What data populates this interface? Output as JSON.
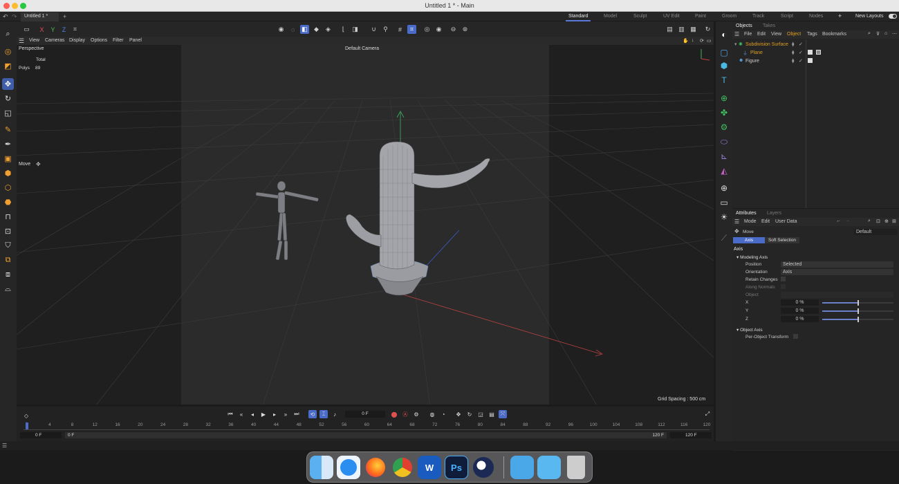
{
  "window": {
    "title": "Untitled 1 * - Main"
  },
  "tabs": {
    "document": "Untitled 1 *",
    "add": "+"
  },
  "layouts": {
    "items": [
      "Standard",
      "Model",
      "Sculpt",
      "UV Edit",
      "Paint",
      "Groom",
      "Track",
      "Script",
      "Nodes"
    ],
    "active": "Standard",
    "add": "+",
    "new_layouts": "New Layouts"
  },
  "axis_toggle": {
    "x": "X",
    "y": "Y",
    "z": "Z"
  },
  "viewport_menu": [
    "View",
    "Cameras",
    "Display",
    "Options",
    "Filter",
    "Panel"
  ],
  "viewport": {
    "view_name": "Perspective",
    "camera": "Default Camera",
    "stats_header": "Total",
    "stats_label": "Polys",
    "stats_value": "89",
    "tool_label": "Move",
    "grid_spacing": "Grid Spacing : 500 cm"
  },
  "timeline": {
    "current_frame": "0 F",
    "ticks": [
      "0",
      "4",
      "8",
      "12",
      "16",
      "20",
      "24",
      "28",
      "32",
      "36",
      "40",
      "44",
      "48",
      "52",
      "56",
      "60",
      "64",
      "68",
      "72",
      "76",
      "80",
      "84",
      "88",
      "92",
      "96",
      "100",
      "104",
      "108",
      "112",
      "116",
      "120"
    ],
    "range_start": "0 F",
    "range_start2": "0 F",
    "range_end": "120 F",
    "range_end2": "120 F"
  },
  "objects_panel": {
    "tabs": [
      "Objects",
      "Takes"
    ],
    "menu": [
      "File",
      "Edit",
      "View",
      "Object",
      "Tags",
      "Bookmarks"
    ],
    "items": [
      {
        "name": "Subdivision Surface",
        "color": "#e0a020"
      },
      {
        "name": "Plane",
        "color": "#e0a020"
      },
      {
        "name": "Figure",
        "color": "#d0d0d0"
      }
    ]
  },
  "attributes_panel": {
    "tabs": [
      "Attributes",
      "Layers"
    ],
    "menu": [
      "Mode",
      "Edit",
      "User Data"
    ],
    "tool": "Move",
    "preset": "Default",
    "subtabs": [
      "Axis",
      "Soft Selection"
    ],
    "section": "Axis",
    "group1": "Modeling Axis",
    "position_label": "Position",
    "position_value": "Selected",
    "orientation_label": "Orientation",
    "orientation_value": "Axis",
    "retain": "Retain Changes",
    "along": "Along Normals",
    "object_label": "Object",
    "x_label": "X",
    "x_value": "0 %",
    "y_label": "Y",
    "y_value": "0 %",
    "z_label": "Z",
    "z_value": "0 %",
    "group2": "Object Axis",
    "per_object": "Per-Object Transform"
  },
  "colors": {
    "accent": "#4a6cc8",
    "x_axis": "#c84040",
    "y_axis": "#40c060",
    "z_axis": "#4060d0"
  },
  "dock": {
    "apps": [
      {
        "icon": "finder-icon"
      },
      {
        "icon": "safari-icon"
      },
      {
        "icon": "firefox-icon"
      },
      {
        "icon": "chrome-icon"
      },
      {
        "icon": "word-icon",
        "glyph": "W"
      },
      {
        "icon": "photoshop-icon",
        "glyph": "Ps"
      },
      {
        "icon": "cinema4d-icon"
      },
      {
        "icon": "appstore-folder-icon"
      },
      {
        "icon": "folder-icon"
      },
      {
        "icon": "trash-icon"
      }
    ]
  }
}
